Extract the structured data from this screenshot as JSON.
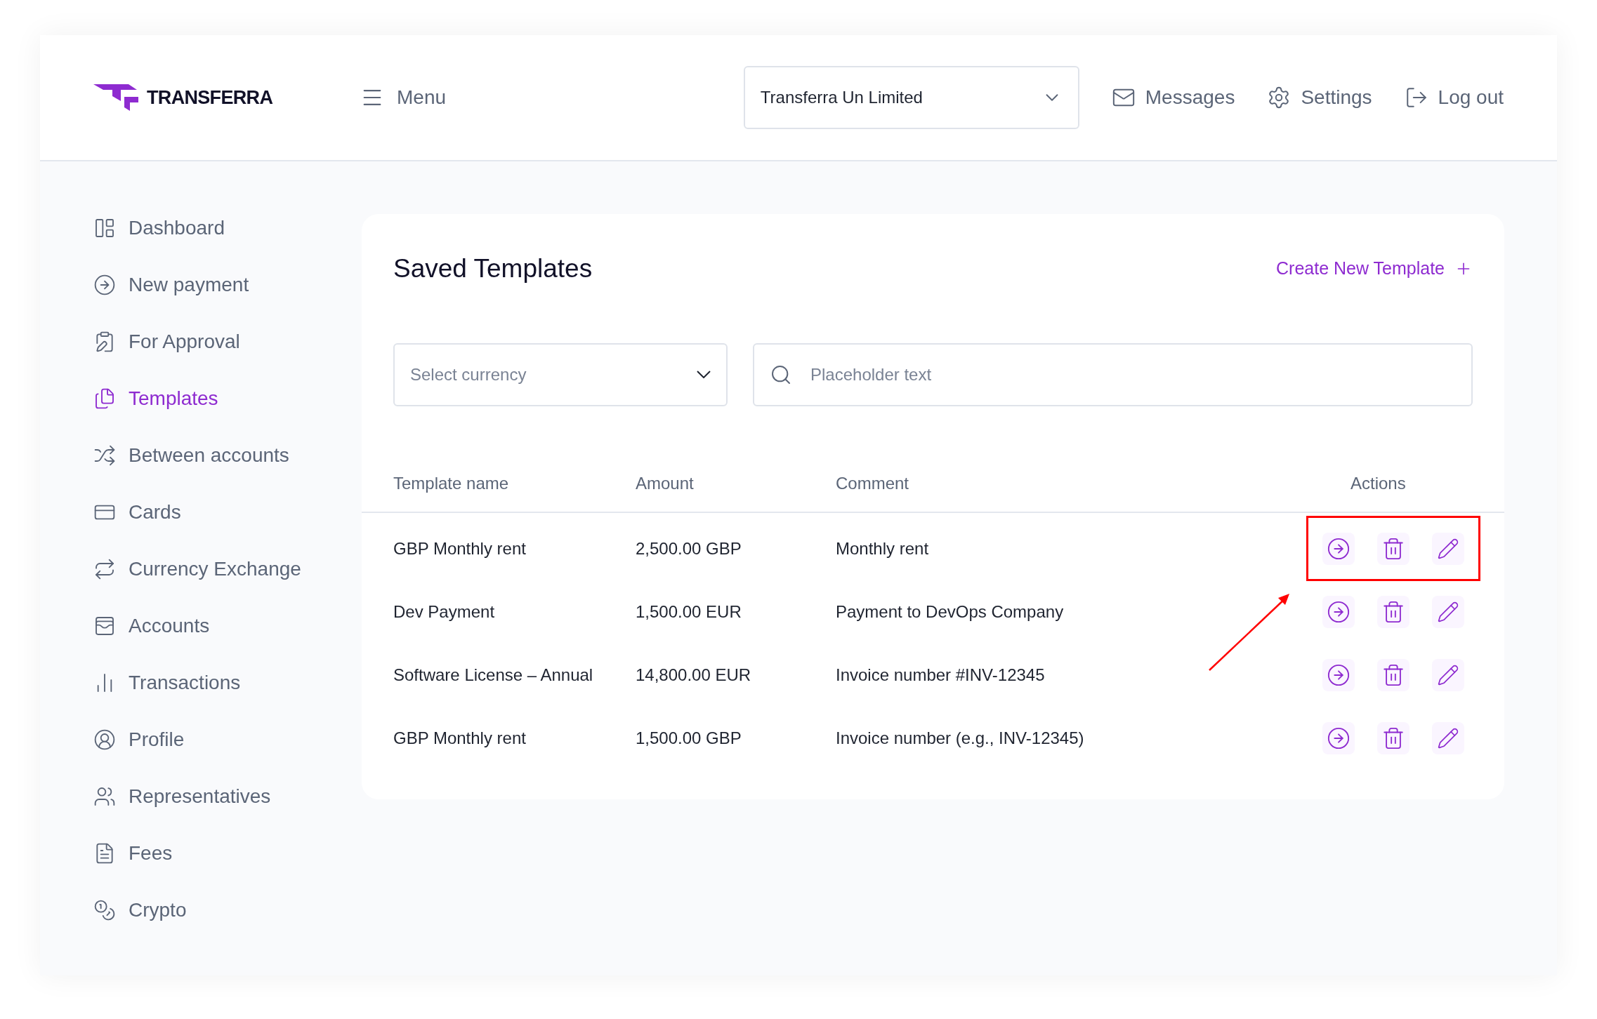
{
  "header": {
    "logo": "TRANSFERRA",
    "menu": "Menu",
    "company_select": {
      "value": "Transferra Un Limited"
    },
    "links": [
      {
        "kind": "messages",
        "label": "Messages"
      },
      {
        "kind": "settings",
        "label": "Settings"
      },
      {
        "kind": "logout",
        "label": "Log out"
      }
    ]
  },
  "sidebar": {
    "items": [
      {
        "kind": "dashboard",
        "label": "Dashboard",
        "selected": false
      },
      {
        "kind": "payment",
        "label": "New payment",
        "selected": false
      },
      {
        "kind": "approval",
        "label": "For Approval",
        "selected": false
      },
      {
        "kind": "templates",
        "label": "Templates",
        "selected": true
      },
      {
        "kind": "between",
        "label": "Between accounts",
        "selected": false
      },
      {
        "kind": "cards",
        "label": "Cards",
        "selected": false
      },
      {
        "kind": "exchange",
        "label": "Currency Exchange",
        "selected": false
      },
      {
        "kind": "accounts",
        "label": "Accounts",
        "selected": false
      },
      {
        "kind": "transactions",
        "label": "Transactions",
        "selected": false
      },
      {
        "kind": "profile",
        "label": "Profile",
        "selected": false
      },
      {
        "kind": "representatives",
        "label": "Representatives",
        "selected": false
      },
      {
        "kind": "fees",
        "label": "Fees",
        "selected": false
      },
      {
        "kind": "crypto",
        "label": "Crypto",
        "selected": false
      }
    ]
  },
  "main": {
    "title": "Saved Templates",
    "create_button": "Create New Template",
    "currency_select": {
      "placeholder": "Select currency"
    },
    "search": {
      "placeholder": "Placeholder text"
    },
    "table": {
      "columns": [
        "Template name",
        "Amount",
        "Comment",
        "Actions"
      ],
      "rows": [
        {
          "name": "GBP Monthly rent",
          "amount": "2,500.00 GBP",
          "comment": "Monthly rent",
          "highlighted": true
        },
        {
          "name": "Dev Payment",
          "amount": "1,500.00 EUR",
          "comment": "Payment to DevOps Company",
          "highlighted": false
        },
        {
          "name": "Software License – Annual",
          "amount": "14,800.00 EUR",
          "comment": "Invoice number #INV-12345",
          "highlighted": false
        },
        {
          "name": "GBP Monthly rent",
          "amount": "1,500.00 GBP",
          "comment": "Invoice number (e.g., INV-12345)",
          "highlighted": false
        }
      ]
    }
  }
}
